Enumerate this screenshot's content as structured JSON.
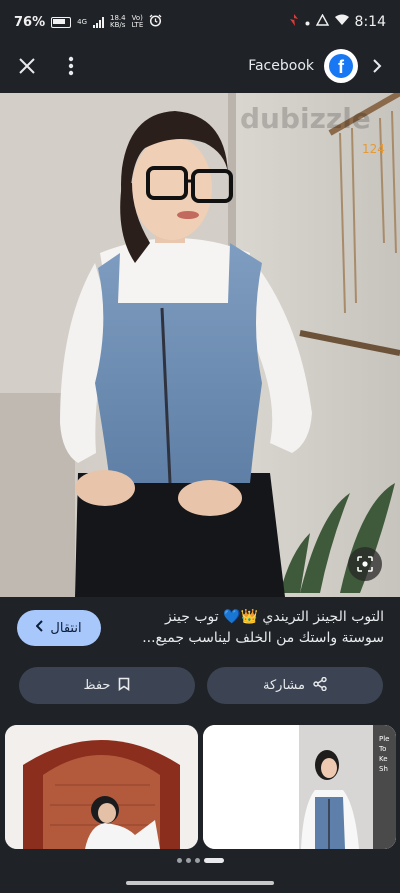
{
  "status_bar": {
    "battery_percent": "76%",
    "network": "4G",
    "speed_value": "18.4",
    "speed_unit": "KB/s",
    "volte_top": "Vo)",
    "volte_bottom": "LTE",
    "time": "8:14"
  },
  "top_bar": {
    "source_name": "Facebook",
    "fb_letter": "f"
  },
  "hero_image": {
    "watermark": "dubizzle"
  },
  "result": {
    "visit_label": "انتقال",
    "title_line1": "التوب الجينز التريندي 👑💙 توب جينز",
    "title_line2": "سوستة واستك من الخلف ليناسب جميع..."
  },
  "actions": {
    "save_label": "حفظ",
    "share_label": "مشاركة"
  },
  "thumbnails": {
    "thumb2_caption_lines": [
      "Ple",
      "To",
      "Ke",
      "Sh"
    ]
  },
  "colors": {
    "background": "#1f2226",
    "accent_button": "#a8c7fa",
    "pill_bg": "#3c4453",
    "facebook_blue": "#1877f2"
  }
}
